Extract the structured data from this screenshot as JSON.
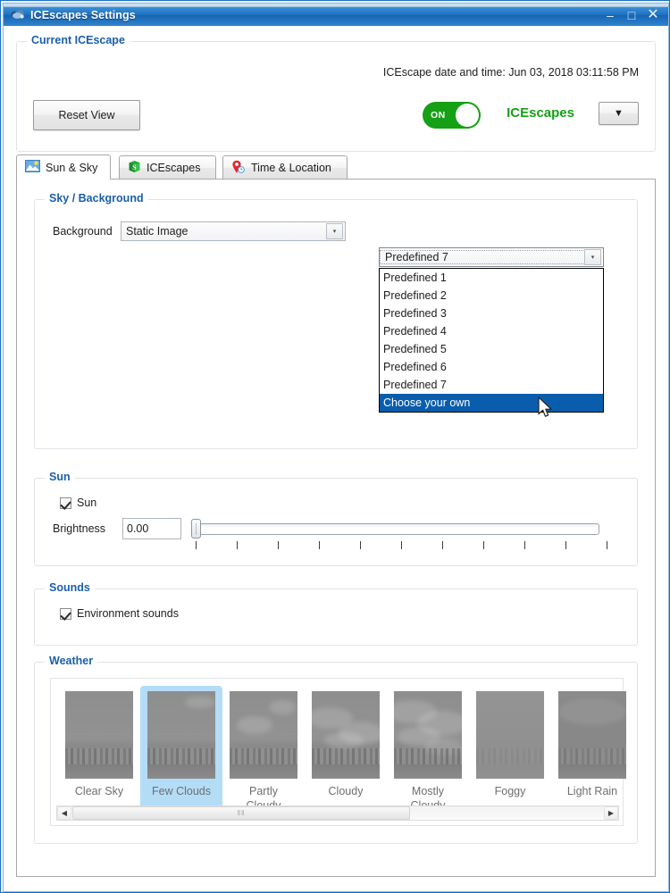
{
  "window": {
    "title": "ICEscapes Settings",
    "app_icon": "cloud-icon",
    "minimize_label": "–",
    "maximize_label": "□",
    "close_label": "✕"
  },
  "current_group": {
    "legend": "Current ICEscape",
    "datetime_label": "ICEscape date and time: Jun 03, 2018  03:11:58 PM",
    "reset_button": "Reset View",
    "toggle": {
      "state_label": "ON",
      "brand_label": "ICEscapes",
      "menu_arrow": "▼"
    }
  },
  "tabs": [
    {
      "label": "Sun & Sky",
      "icon": "sun-sky-icon",
      "active": true
    },
    {
      "label": "ICEscapes",
      "icon": "green-cube-icon",
      "active": false
    },
    {
      "label": "Time & Location",
      "icon": "map-pin-clock-icon",
      "active": false
    }
  ],
  "sky_group": {
    "legend": "Sky / Background",
    "background_label": "Background",
    "background_combo": {
      "value": "Static Image",
      "arrow": "▾"
    },
    "preset_combo": {
      "value": "Predefined 7",
      "arrow": "▾",
      "open": true,
      "options": [
        "Predefined 1",
        "Predefined 2",
        "Predefined 3",
        "Predefined 4",
        "Predefined 5",
        "Predefined 6",
        "Predefined 7",
        "Choose your own"
      ],
      "highlighted": "Choose your own"
    }
  },
  "sun_group": {
    "legend": "Sun",
    "sun_checkbox_label": "Sun",
    "sun_checked": true,
    "brightness_label": "Brightness",
    "brightness_value": "0.00",
    "slider": {
      "min": 0,
      "max": 100,
      "value": 0,
      "tick_count": 11
    }
  },
  "sounds_group": {
    "legend": "Sounds",
    "environment_checkbox_label": "Environment sounds",
    "environment_checked": true
  },
  "weather_group": {
    "legend": "Weather",
    "selected": "Few Clouds",
    "items": [
      {
        "label": "Clear Sky",
        "clouds": 0
      },
      {
        "label": "Few Clouds",
        "clouds": 1
      },
      {
        "label": "Partly\nCloudy",
        "clouds": 2
      },
      {
        "label": "Cloudy",
        "clouds": 3
      },
      {
        "label": "Mostly\nCloudy",
        "clouds": 4
      },
      {
        "label": "Foggy",
        "clouds": 5
      },
      {
        "label": "Light Rain",
        "clouds": 3
      }
    ],
    "scrollbar": {
      "left_arrow": "◀",
      "right_arrow": "▶",
      "grip": "‖‖"
    }
  },
  "colors": {
    "accent_blue": "#1a5fa8",
    "title_blue": "#1d6fc0",
    "toggle_green": "#16a016",
    "selection_blue": "#0a5dad",
    "selected_thumb": "#b3dcf7"
  }
}
